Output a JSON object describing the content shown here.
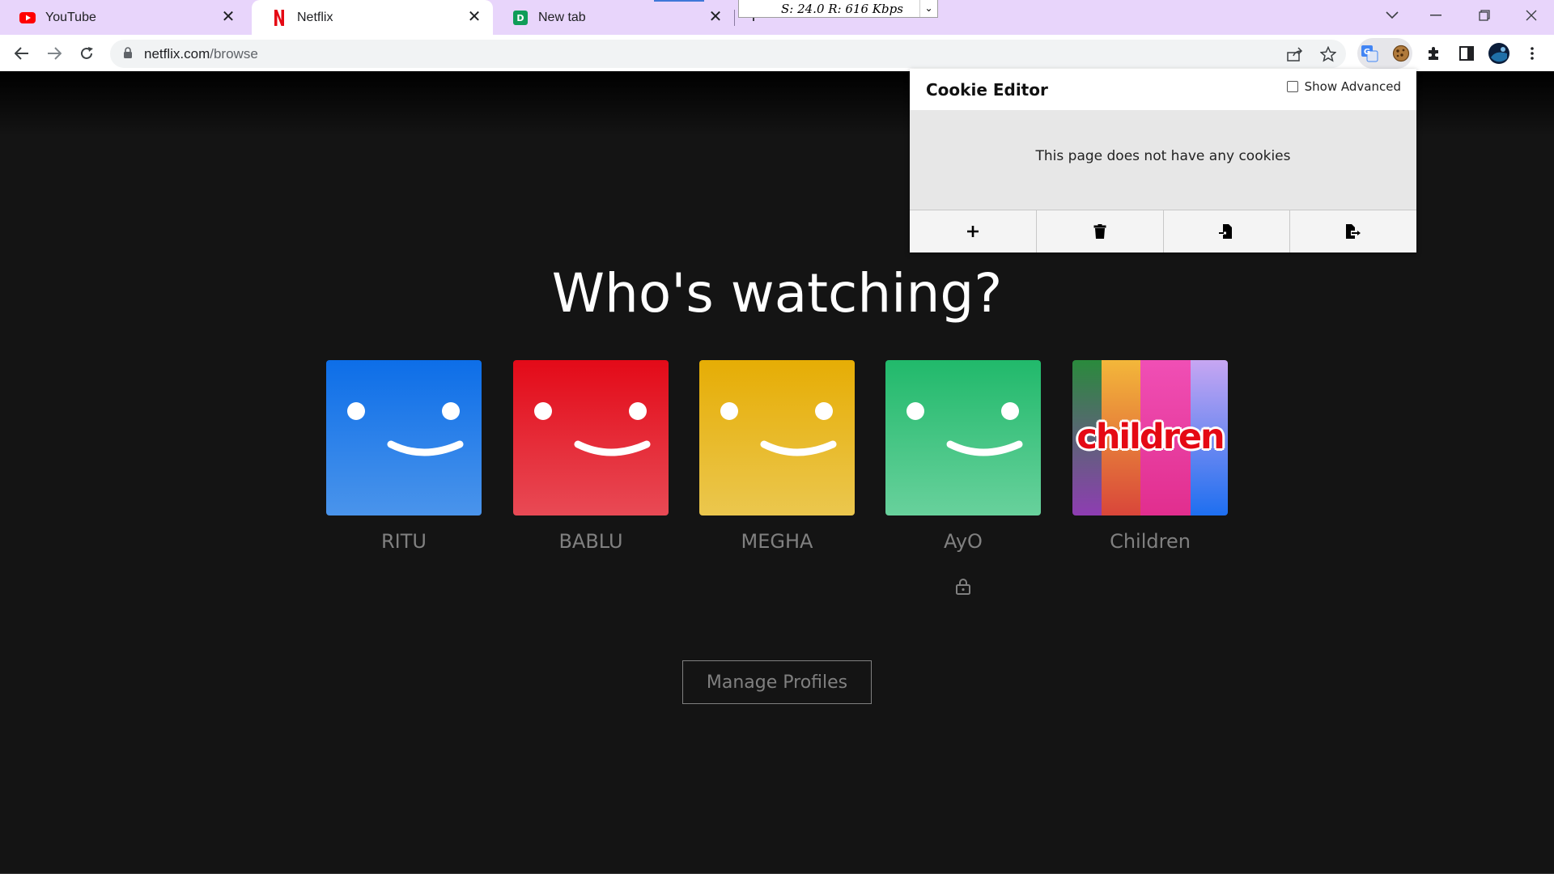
{
  "browser": {
    "tabs": [
      {
        "title": "YouTube",
        "icon": "youtube-icon",
        "active": false
      },
      {
        "title": "Netflix",
        "icon": "netflix-icon",
        "active": true
      },
      {
        "title": "New tab",
        "icon": "new-tab-favicon",
        "active": false
      }
    ],
    "speed_widget": "S: 24.0 R: 616 Kbps",
    "url_host": "netflix.com",
    "url_path": "/browse"
  },
  "cookie_editor": {
    "title": "Cookie Editor",
    "show_advanced_label": "Show Advanced",
    "message": "This page does not have any cookies",
    "actions": [
      "add",
      "delete",
      "import",
      "export"
    ]
  },
  "netflix": {
    "heading": "Who's watching?",
    "profiles": [
      {
        "name": "RITU",
        "color": "#2f7fdc",
        "locked": false
      },
      {
        "name": "BABLU",
        "color": "#e0131f",
        "locked": false
      },
      {
        "name": "MEGHA",
        "color": "#e6b10c",
        "locked": false
      },
      {
        "name": "AyO",
        "color": "#2dbe75",
        "locked": true
      },
      {
        "name": "Children",
        "logo_text": "children",
        "locked": false
      }
    ],
    "manage_button": "Manage Profiles"
  },
  "colors": {
    "tabstrip": "#e8d5fb",
    "page_bg": "#141414",
    "netflix_red": "#e50914"
  }
}
